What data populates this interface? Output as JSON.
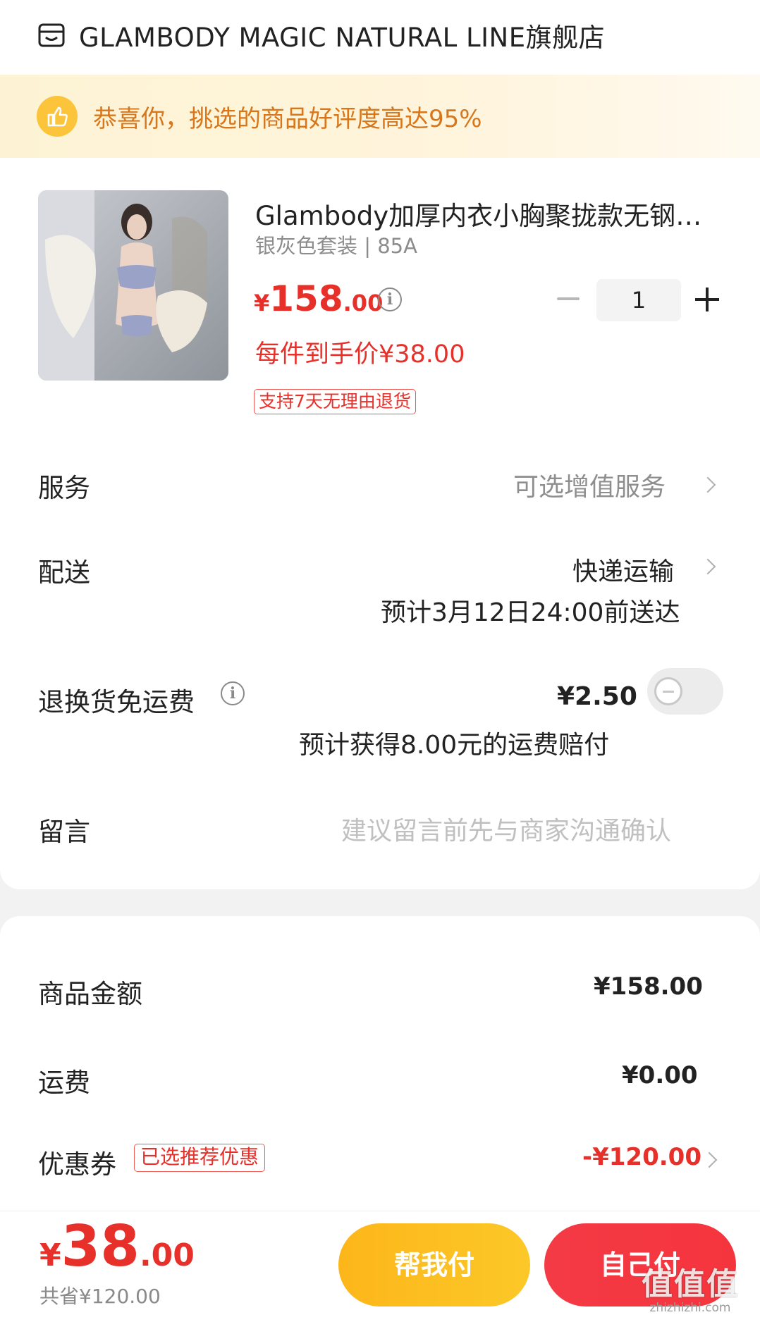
{
  "store": {
    "icon": "store-icon",
    "name": "GLAMBODY MAGIC NATURAL LINE旗舰店"
  },
  "banner": {
    "icon": "thumbs-up-icon",
    "text": "恭喜你，挑选的商品好评度高达95%",
    "text_color": "#d7761a",
    "background": "#fdf3d4"
  },
  "product": {
    "image": "product-photo",
    "title": "Glambody加厚内衣小胸聚拢款无钢圈套装",
    "spec": "银灰色套装 | 85A",
    "price_currency": "¥",
    "price_int": "158",
    "price_dec": ".00",
    "each_price": "每件到手价¥38.00",
    "return_tag": "支持7天无理由退货",
    "quantity": "1"
  },
  "rows": {
    "service_label": "服务",
    "service_value": "可选增值服务",
    "delivery_label": "配送",
    "delivery_value": "快递运输",
    "delivery_eta": "预计3月12日24:00前送达",
    "return_label": "退换货免运费",
    "return_value": "¥2.50",
    "return_note": "预计获得8.00元的运费赔付",
    "return_toggle_on": false,
    "message_label": "留言",
    "message_placeholder": "建议留言前先与商家沟通确认"
  },
  "summary": {
    "goods_label": "商品金额",
    "goods_value": "¥158.00",
    "shipping_label": "运费",
    "shipping_value": "¥0.00",
    "coupon_label": "优惠券",
    "coupon_tag": "已选推荐优惠",
    "coupon_value": "-¥120.00"
  },
  "footer": {
    "total_currency": "¥",
    "total_int": "38",
    "total_dec": ".00",
    "saved": "共省¥120.00",
    "help_pay": "帮我付",
    "self_pay": "自己付"
  },
  "watermark": {
    "big": "值值值",
    "small": "zhizhizhi.com"
  },
  "colors": {
    "accent_red": "#e8302a",
    "help_btn": "#fdb61a",
    "self_btn": "#f43a45"
  }
}
